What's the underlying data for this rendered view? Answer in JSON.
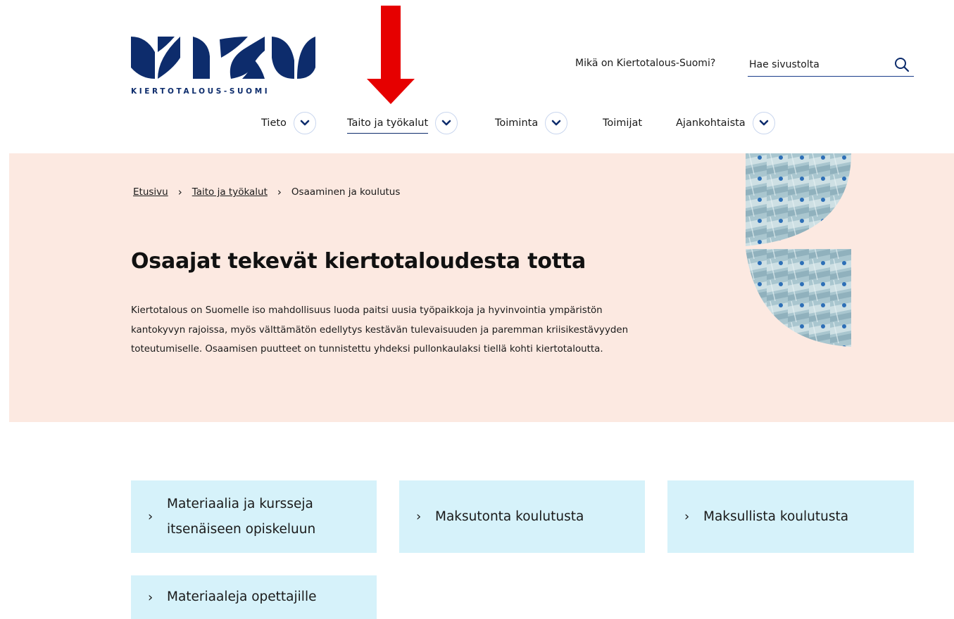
{
  "logo": {
    "tagline": "KIERTOTALOUS-SUOMI",
    "brand_color": "#0d2c6c"
  },
  "header": {
    "about_link": "Mikä on Kiertotalous-Suomi?",
    "search": {
      "placeholder": "Hae sivustolta",
      "value": "",
      "icon": "search-icon"
    }
  },
  "nav": {
    "items": [
      {
        "label": "Tieto",
        "has_dropdown": true
      },
      {
        "label": "Taito ja työkalut",
        "has_dropdown": true,
        "active": true
      },
      {
        "label": "Toiminta",
        "has_dropdown": true
      },
      {
        "label": "Toimijat",
        "has_dropdown": false
      },
      {
        "label": "Ajankohtaista",
        "has_dropdown": true
      }
    ]
  },
  "annotation": {
    "type": "red-arrow",
    "color": "#e60000"
  },
  "breadcrumb": {
    "items": [
      "Etusivu",
      "Taito ja työkalut",
      "Osaaminen ja koulutus"
    ],
    "separator": "›"
  },
  "hero": {
    "title": "Osaajat tekevät kiertotaloudesta totta",
    "body": "Kiertotalous on Suomelle iso mahdollisuus luoda paitsi uusia työpaikkoja ja hyvinvointia ympäristön kantokyvyn rajoissa, myös välttämätön edellytys kestävän tulevaisuuden ja paremman kriisikestävyyden toteutumiselle. Osaamisen puutteet on tunnistettu yhdeksi pullonkaulaksi tiellä kohti kiertotaloutta.",
    "background": "#fce9e1"
  },
  "cards": {
    "arrow": "›",
    "background": "#d6f2fa",
    "items": [
      {
        "label": "Materiaalia ja kursseja itsenäiseen opiskeluun"
      },
      {
        "label": "Maksutonta koulutusta"
      },
      {
        "label": "Maksullista koulutusta"
      },
      {
        "label": "Materiaaleja opettajille"
      }
    ]
  }
}
